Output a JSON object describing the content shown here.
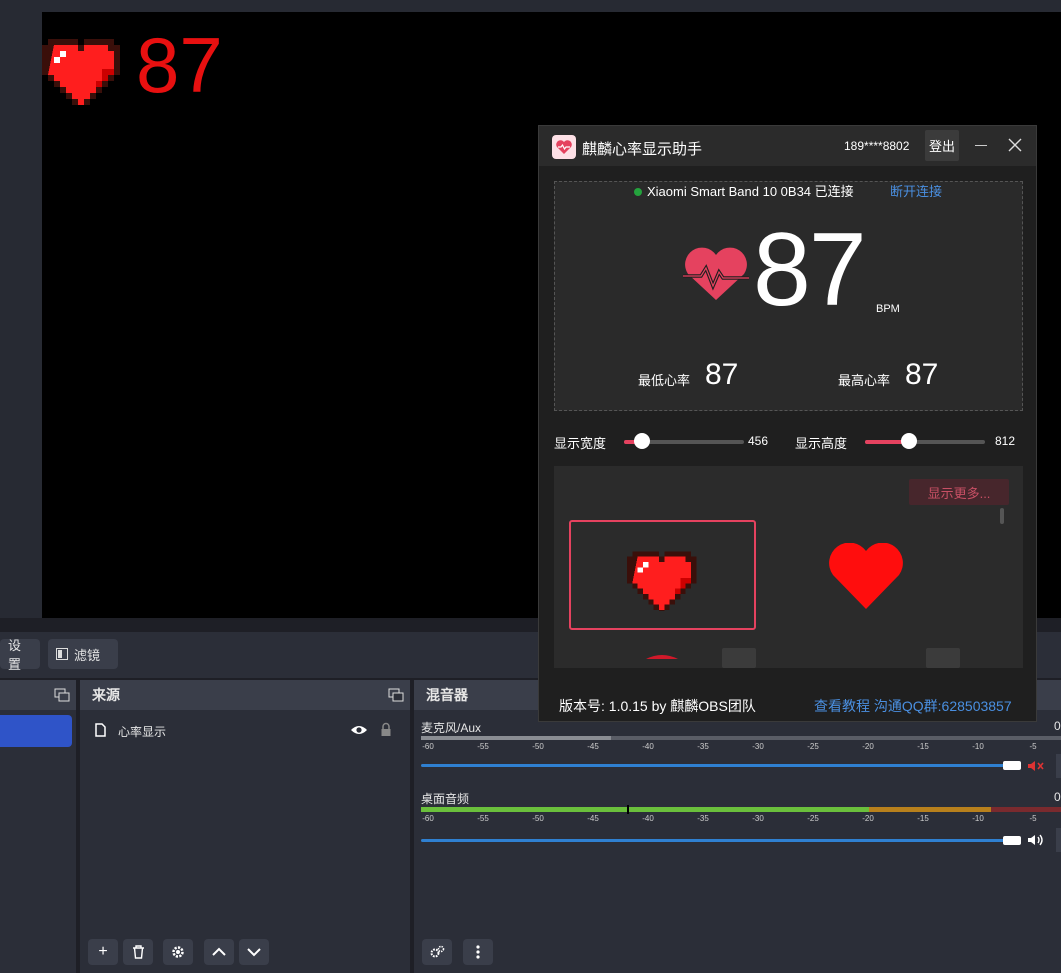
{
  "obs": {
    "preview_bpm": "87",
    "properties_bar": {
      "settings_label": "设置",
      "filters_label": "滤镜"
    },
    "sources": {
      "title": "来源",
      "items": [
        {
          "label": "心率显示"
        }
      ]
    },
    "mixer": {
      "title": "混音器",
      "channels": [
        {
          "name": "麦克风/Aux",
          "muted": true,
          "value": "0"
        },
        {
          "name": "桌面音频",
          "muted": false,
          "value": "0"
        }
      ],
      "scale": [
        "-60",
        "-55",
        "-50",
        "-45",
        "-40",
        "-35",
        "-30",
        "-25",
        "-20",
        "-15",
        "-10",
        "-5"
      ]
    }
  },
  "helper": {
    "title": "麒麟心率显示助手",
    "phone": "189****8802",
    "login_label": "登出",
    "connection": {
      "text": "Xiaomi Smart Band 10 0B34 已连接",
      "action": "断开连接",
      "status_color": "#24a33d"
    },
    "bpm": "87",
    "bpm_unit": "BPM",
    "min_label": "最低心率",
    "min_value": "87",
    "max_label": "最高心率",
    "max_value": "87",
    "width_label": "显示宽度",
    "width_value": "456",
    "width_fraction": 0.15,
    "height_label": "显示高度",
    "height_value": "812",
    "height_fraction": 0.37,
    "show_more_label": "显示更多...",
    "footer_version": "版本号: 1.0.15 by 麒麟OBS团队",
    "footer_links": "查看教程 沟通QQ群:628503857",
    "accent_color": "#e5425f"
  }
}
